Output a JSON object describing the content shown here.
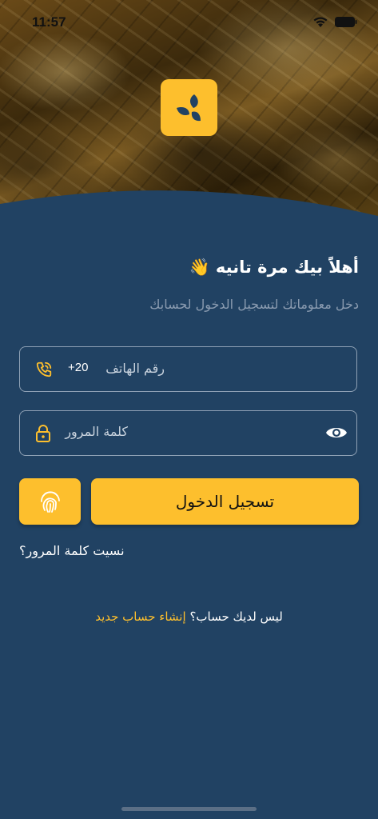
{
  "status_bar": {
    "time": "11:57"
  },
  "welcome": {
    "title": "أهلاً بيك مرة تانيه 👋",
    "subtitle": "دخل معلوماتك لتسجيل الدخول لحسابك"
  },
  "phone_field": {
    "label": "رقم الهاتف",
    "country_code": "+20",
    "icon": "phone-call-icon"
  },
  "password_field": {
    "label": "كلمة المرور",
    "icon": "lock-icon",
    "toggle_icon": "eye-icon"
  },
  "actions": {
    "login_label": "تسجيل الدخول",
    "fingerprint_icon": "fingerprint-icon",
    "forgot_password": "نسيت كلمة المرور؟"
  },
  "signup": {
    "prompt": "ليس لديك حساب؟",
    "link": "إنشاء حساب جديد"
  },
  "colors": {
    "background": "#214263",
    "accent": "#FDBF2D",
    "muted_text": "#8a9bb0"
  }
}
